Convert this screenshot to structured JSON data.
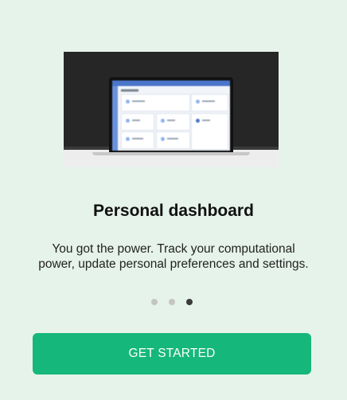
{
  "onboarding": {
    "title": "Personal dashboard",
    "description": "You got the power. Track your computational power, update personal preferences and settings.",
    "page_count": 3,
    "current_page": 3,
    "cta_label": "GET STARTED"
  },
  "colors": {
    "background": "#e6f3ea",
    "button": "#16b77a",
    "button_text": "#ffffff",
    "dot_inactive": "#c4c4c4",
    "dot_active": "#3b3b3b"
  }
}
